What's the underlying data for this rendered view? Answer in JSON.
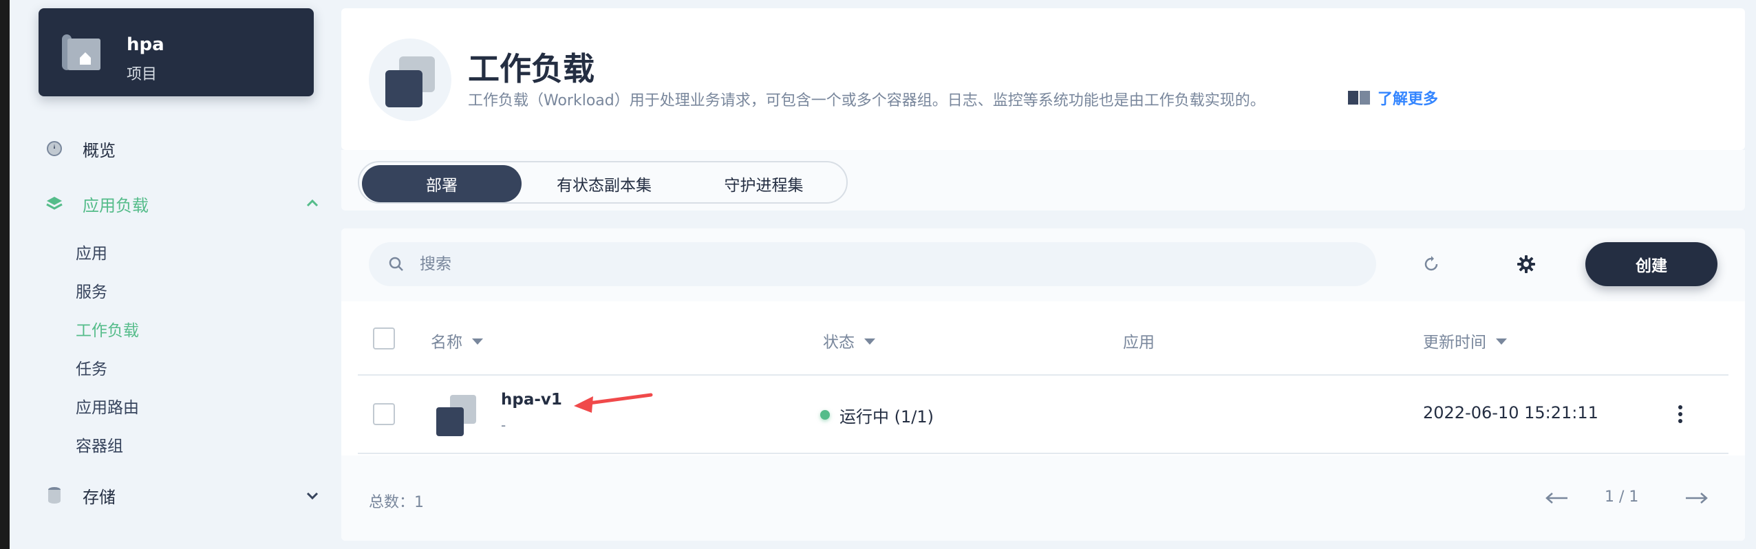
{
  "project": {
    "name": "hpa",
    "type": "项目"
  },
  "nav": {
    "overview": "概览",
    "workloads_group": "应用负载",
    "sub_items": [
      "应用",
      "服务",
      "工作负载",
      "任务",
      "应用路由",
      "容器组"
    ],
    "active_sub": "工作负载",
    "storage": "存储"
  },
  "header": {
    "title": "工作负载",
    "description": "工作负载（Workload）用于处理业务请求，可包含一个或多个容器组。日志、监控等系统功能也是由工作负载实现的。",
    "learn_more": "了解更多"
  },
  "tabs": [
    {
      "label": "部署",
      "active": true
    },
    {
      "label": "有状态副本集",
      "active": false
    },
    {
      "label": "守护进程集",
      "active": false
    }
  ],
  "toolbar": {
    "search_placeholder": "搜索",
    "create_label": "创建",
    "icons": [
      "refresh-icon",
      "gear-icon"
    ]
  },
  "table": {
    "columns": [
      "名称",
      "状态",
      "应用",
      "更新时间"
    ],
    "rows": [
      {
        "name": "hpa-v1",
        "sub": "-",
        "status": "运行中 (1/1)",
        "status_color": "#55bc8a",
        "app": "",
        "updated": "2022-06-10 15:21:11"
      }
    ]
  },
  "footer": {
    "total": "总数：1",
    "page": "1 / 1"
  },
  "colors": {
    "accent_green": "#55bc8a",
    "dark": "#242e42",
    "link_blue": "#3385ff",
    "annotation_red": "#f0494a"
  }
}
